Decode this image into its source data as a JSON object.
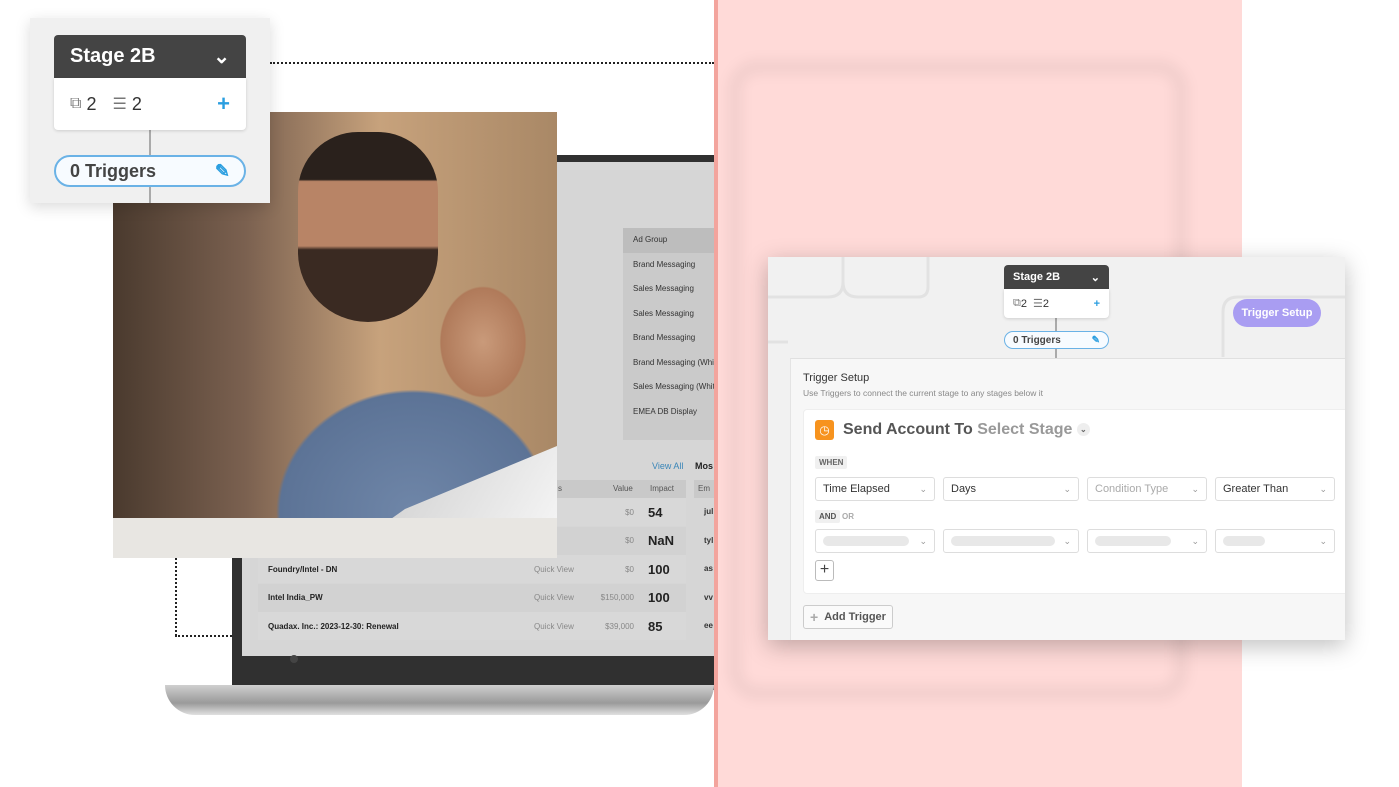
{
  "colors": {
    "accent_pink": "#ffdad8",
    "pill_border": "#6ab2e6",
    "trigger_icon": "#f7931e",
    "trigger_setup_pill": "#a99df2"
  },
  "stage_card": {
    "title": "Stage 2B",
    "copies_count": "2",
    "tasks_count": "2",
    "triggers_label": "0 Triggers"
  },
  "laptop": {
    "ad_groups": [
      "Ad Group",
      "Brand Messaging",
      "Sales Messaging",
      "Sales Messaging",
      "Brand Messaging",
      "Brand Messaging (Whi",
      "Sales Messaging (Whit",
      "EMEA DB Display"
    ],
    "view_all": "View All",
    "most_label": "Mos",
    "headers": {
      "name": "s",
      "value": "Value",
      "impact": "Impact",
      "email": "Em"
    },
    "rows": [
      {
        "name": "",
        "action": "View",
        "value": "$0",
        "impact": "54",
        "email": "jul"
      },
      {
        "name": "",
        "action": "View",
        "value": "$0",
        "impact": "NaN",
        "email": "tyl"
      },
      {
        "name": "Foundry/Intel - DN",
        "action": "Quick View",
        "value": "$0",
        "impact": "100",
        "email": "as"
      },
      {
        "name": "Intel India_PW",
        "action": "Quick View",
        "value": "$150,000",
        "impact": "100",
        "email": "vv"
      },
      {
        "name": "Quadax. Inc.: 2023-12-30: Renewal",
        "action": "Quick View",
        "value": "$39,000",
        "impact": "85",
        "email": "ee"
      }
    ]
  },
  "panel": {
    "stage": {
      "title": "Stage 2B",
      "copies_count": "2",
      "tasks_count": "2",
      "triggers_label": "0 Triggers"
    },
    "trigger_setup_pill": "Trigger Setup",
    "title": "Trigger Setup",
    "subtitle": "Use Triggers to connect the current stage to any stages below it",
    "send_label": "Send Account To",
    "stage_select": "Select Stage",
    "when": "WHEN",
    "and": "AND",
    "or": "OR",
    "conditions": [
      "Time Elapsed",
      "Days",
      "Condition Type",
      "Greater Than"
    ],
    "add_trigger": "Add Trigger"
  }
}
